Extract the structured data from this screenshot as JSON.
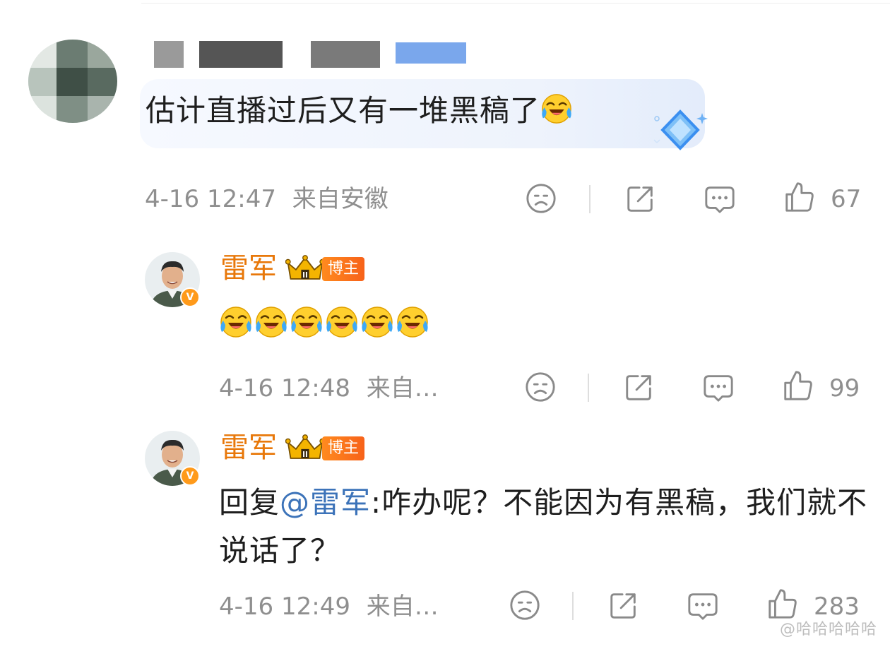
{
  "comment": {
    "text": "估计直播过后又有一堆黑稿了",
    "time": "4-16 12:47",
    "location": "来自安徽",
    "likes": "67",
    "icons": [
      "sad-face-icon",
      "share-icon",
      "comment-icon",
      "thumbs-up-icon"
    ]
  },
  "replies": [
    {
      "author": "雷军",
      "tag": "博主",
      "emoji_count": 6,
      "time": "4-16 12:48",
      "location": "来自…",
      "likes": "99"
    },
    {
      "author": "雷军",
      "tag": "博主",
      "reply_prefix": "回复",
      "mention": "@雷军",
      "text": ":咋办呢？不能因为有黑稿，我们就不说话了？",
      "time": "4-16 12:49",
      "location": "来自…",
      "likes": "283"
    }
  ],
  "colors": {
    "author_name": "#e8780a",
    "mention": "#3c73b9",
    "meta_gray": "#8f8f8f"
  },
  "watermark": "@哈哈哈哈哈"
}
